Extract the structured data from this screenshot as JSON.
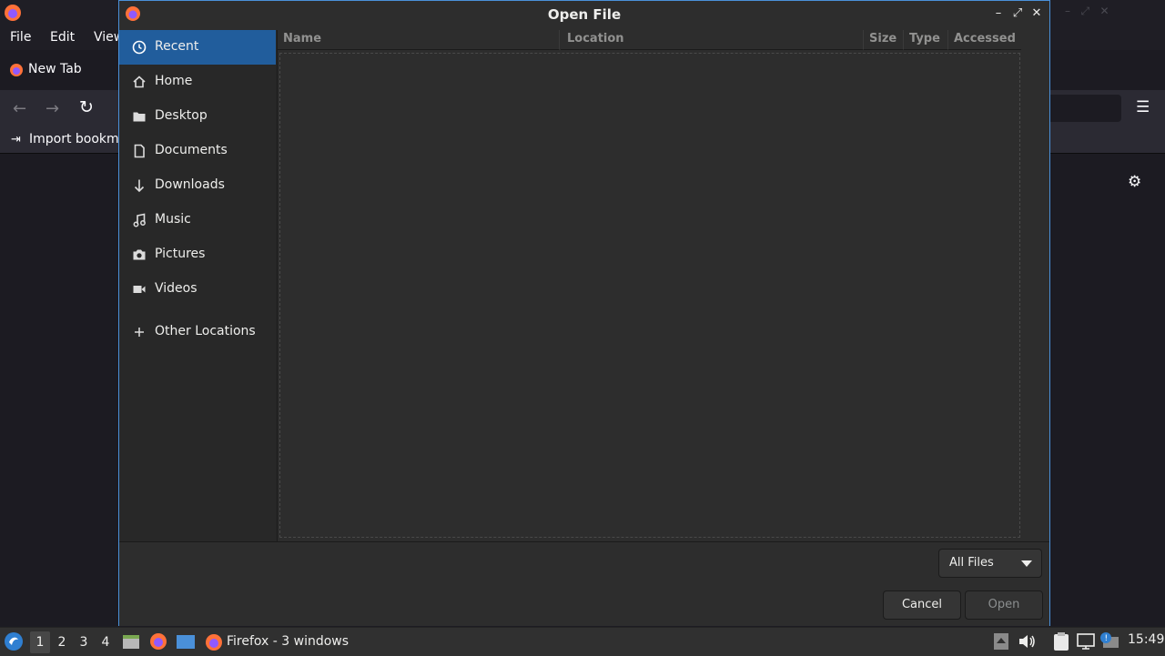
{
  "firefox": {
    "menu": [
      "File",
      "Edit",
      "View"
    ],
    "tab_title": "New Tab",
    "bookmark_import_label": "Import bookmarks"
  },
  "dialog": {
    "title": "Open File",
    "sidebar": [
      {
        "label": "Recent",
        "icon": "clock-icon",
        "active": true
      },
      {
        "label": "Home",
        "icon": "home-icon"
      },
      {
        "label": "Desktop",
        "icon": "folder-icon"
      },
      {
        "label": "Documents",
        "icon": "document-icon"
      },
      {
        "label": "Downloads",
        "icon": "download-arrow-icon"
      },
      {
        "label": "Music",
        "icon": "music-note-icon"
      },
      {
        "label": "Pictures",
        "icon": "camera-icon"
      },
      {
        "label": "Videos",
        "icon": "video-icon"
      },
      {
        "label": "Other Locations",
        "icon": "plus-icon"
      }
    ],
    "columns": [
      "Name",
      "Location",
      "Size",
      "Type",
      "Accessed"
    ],
    "filter": "All Files",
    "cancel_label": "Cancel",
    "open_label": "Open"
  },
  "taskbar": {
    "workspaces": [
      "1",
      "2",
      "3",
      "4"
    ],
    "active_workspace": "1",
    "task_label": "Firefox - 3 windows",
    "clock": "15:49"
  },
  "colors": {
    "accent": "#215d9c",
    "dialog_border": "#4a90d9",
    "firefox_orange": "#ff7139"
  }
}
